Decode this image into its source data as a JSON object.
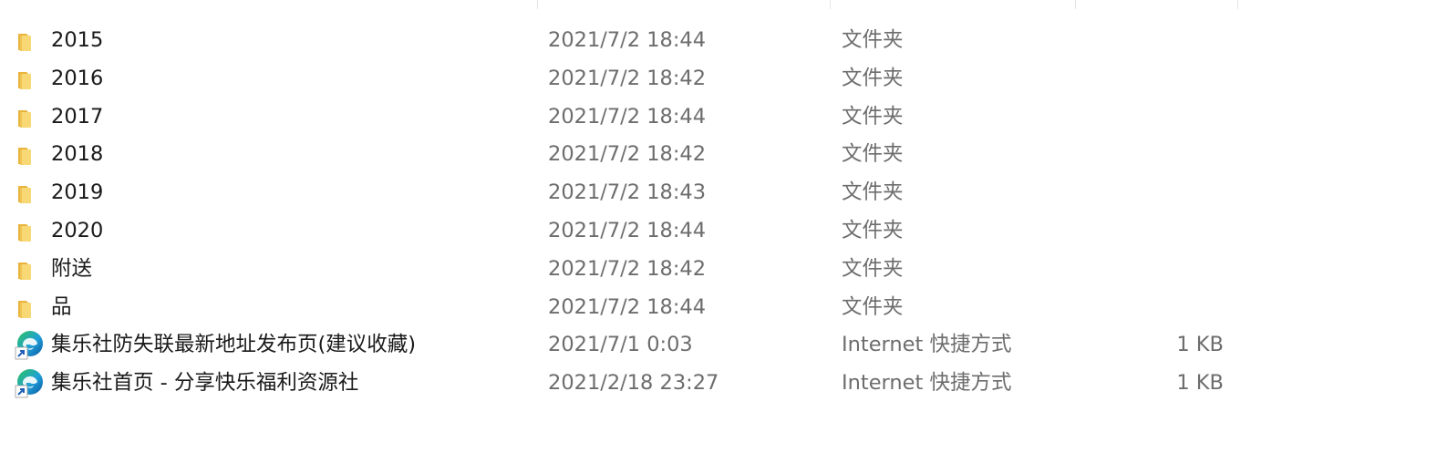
{
  "columns": [
    "name",
    "date_modified",
    "type",
    "size"
  ],
  "colors": {
    "folder_body": "#f8d775",
    "folder_tab": "#e8b43c",
    "edge_blue": "#0c59a4",
    "edge_green": "#2fc35c",
    "edge_teal": "#1fa0d8",
    "text_primary": "#1a1a1a",
    "text_secondary": "#6d6d6d"
  },
  "files": [
    {
      "name": "2015",
      "date": "2021/7/2 18:44",
      "type": "文件夹",
      "size": "",
      "icon": "folder-icon"
    },
    {
      "name": "2016",
      "date": "2021/7/2 18:42",
      "type": "文件夹",
      "size": "",
      "icon": "folder-icon"
    },
    {
      "name": "2017",
      "date": "2021/7/2 18:44",
      "type": "文件夹",
      "size": "",
      "icon": "folder-icon"
    },
    {
      "name": "2018",
      "date": "2021/7/2 18:42",
      "type": "文件夹",
      "size": "",
      "icon": "folder-icon"
    },
    {
      "name": "2019",
      "date": "2021/7/2 18:43",
      "type": "文件夹",
      "size": "",
      "icon": "folder-icon"
    },
    {
      "name": "2020",
      "date": "2021/7/2 18:44",
      "type": "文件夹",
      "size": "",
      "icon": "folder-icon"
    },
    {
      "name": "附送",
      "date": "2021/7/2 18:42",
      "type": "文件夹",
      "size": "",
      "icon": "folder-icon"
    },
    {
      "name": "品",
      "date": "2021/7/2 18:44",
      "type": "文件夹",
      "size": "",
      "icon": "folder-icon"
    },
    {
      "name": "集乐社防失联最新地址发布页(建议收藏)",
      "date": "2021/7/1 0:03",
      "type": "Internet 快捷方式",
      "size": "1 KB",
      "icon": "edge-shortcut-icon"
    },
    {
      "name": "集乐社首页 - 分享快乐福利资源社",
      "date": "2021/2/18 23:27",
      "type": "Internet 快捷方式",
      "size": "1 KB",
      "icon": "edge-shortcut-icon"
    }
  ]
}
